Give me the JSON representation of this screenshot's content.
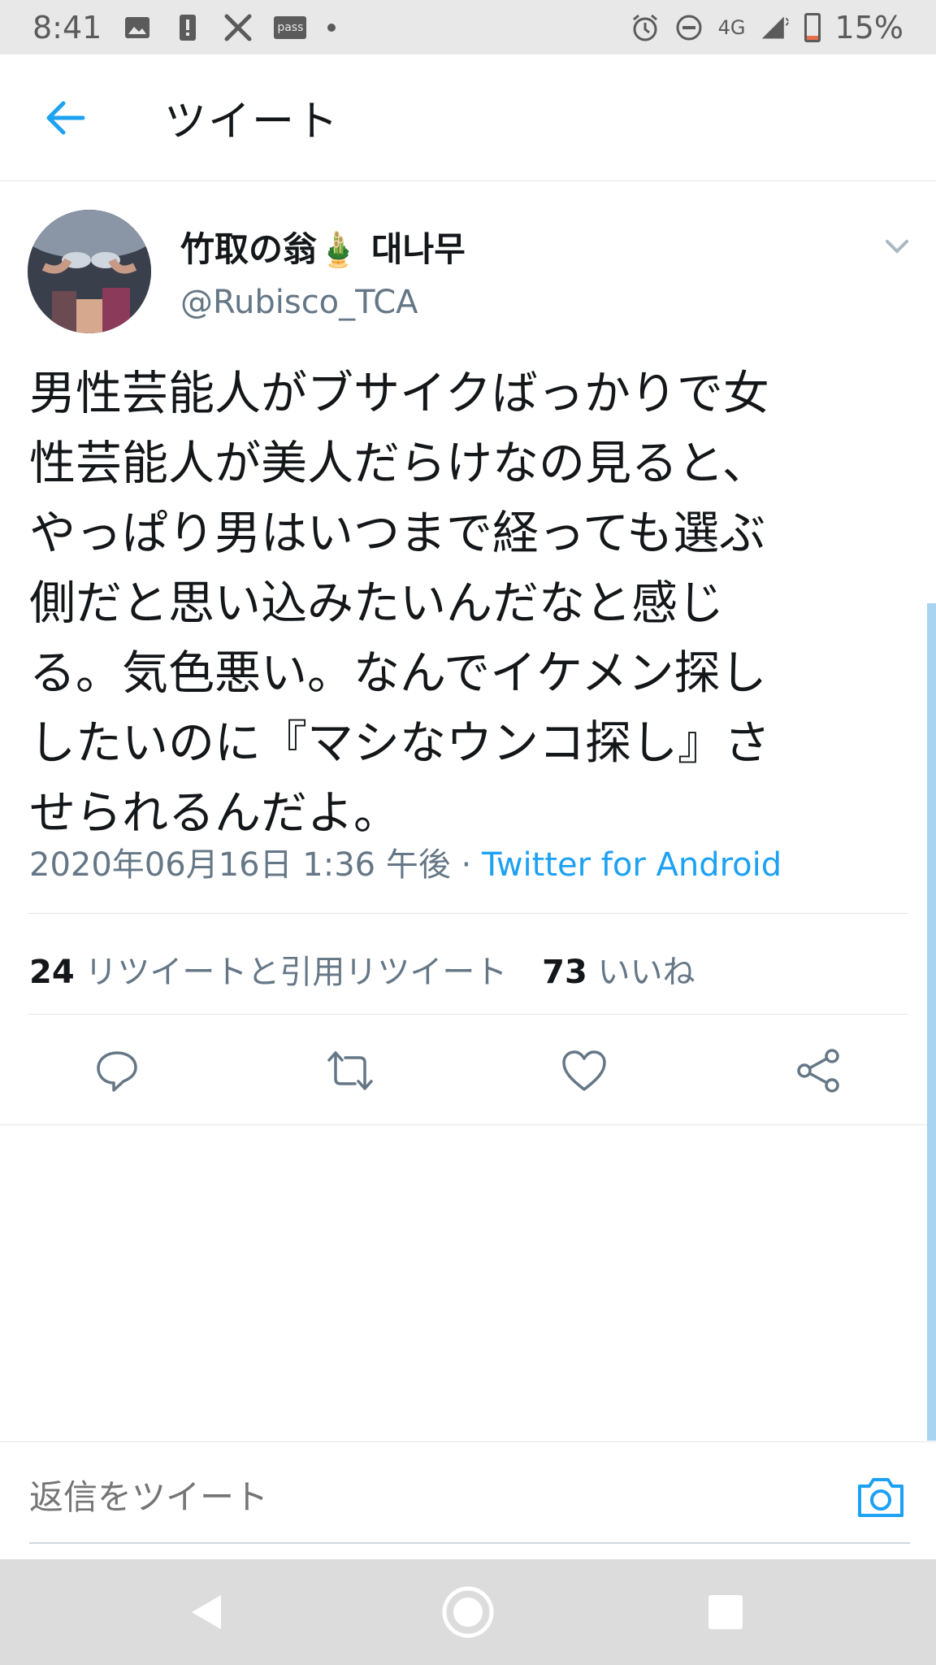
{
  "status_bar": {
    "time": "8:41",
    "network": "4G",
    "battery": "15%",
    "battery_level": 0.15,
    "icons": [
      "image-icon",
      "alert-icon",
      "game-icon",
      "pass-icon",
      "dot-icon",
      "alarm-icon",
      "do-not-disturb-icon",
      "signal-icon",
      "battery-icon"
    ],
    "pass_label": "pass"
  },
  "header": {
    "title": "ツイート",
    "back_icon": "arrow-left-icon"
  },
  "tweet": {
    "author_name": "竹取の翁🎍 대나무",
    "author_handle": "@Rubisco_TCA",
    "text": "男性芸能人がブサイクばっかりで女\n性芸能人が美人だらけなの見ると、\nやっぱり男はいつまで経っても選ぶ\n側だと思い込みたいんだなと感じ\nる。気色悪い。なんでイケメン探し\nしたいのに『マシなウンコ探し』さ\nせられるんだよ。",
    "timestamp": "2020年06月16日 1:36 午後 · ",
    "source": "Twitter for Android",
    "retweet_count": "24",
    "retweet_label": "リツイートと引用リツイート",
    "like_count": "73",
    "like_label": "いいね"
  },
  "reply": {
    "placeholder": "返信をツイート"
  },
  "colors": {
    "accent": "#1da1f2",
    "text": "#14171a",
    "secondary": "#657786",
    "divider": "#e1e8ed"
  }
}
